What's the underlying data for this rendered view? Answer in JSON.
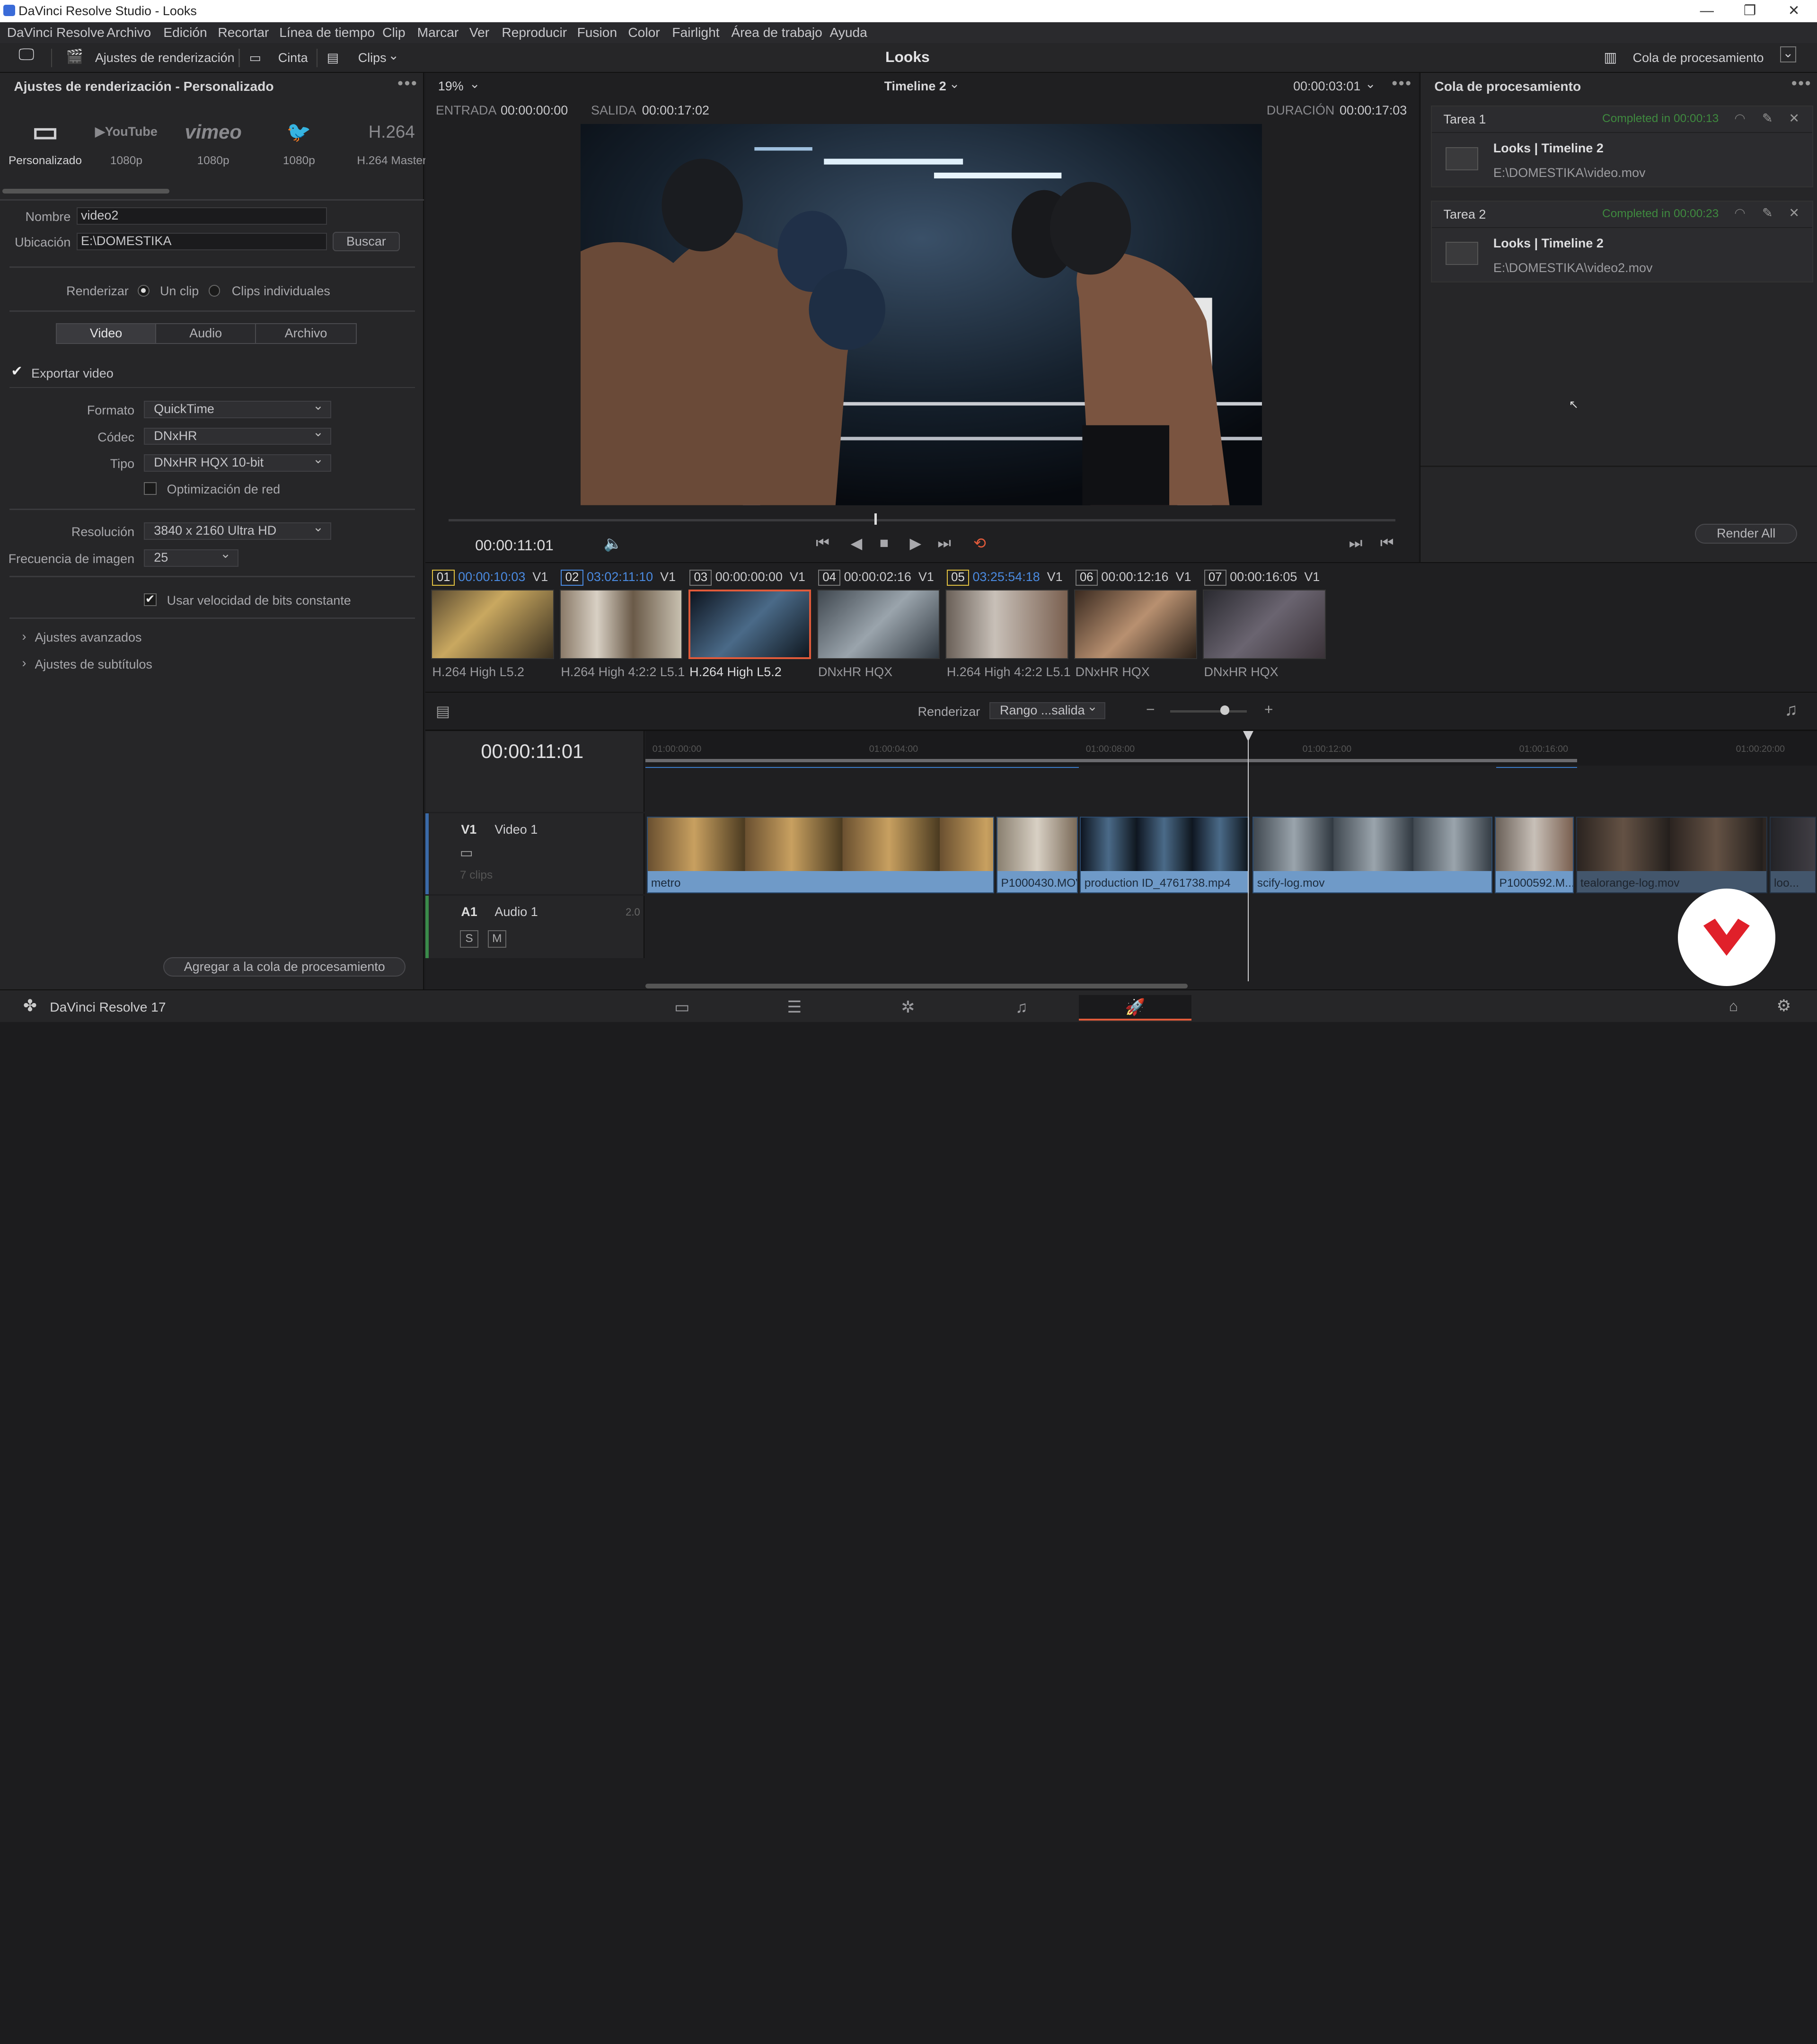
{
  "window": {
    "title": "DaVinci Resolve Studio - Looks",
    "minimize": "—",
    "restore": "❐",
    "close": "✕"
  },
  "menu": [
    "DaVinci Resolve",
    "Archivo",
    "Edición",
    "Recortar",
    "Línea de tiempo",
    "Clip",
    "Marcar",
    "Ver",
    "Reproducir",
    "Fusion",
    "Color",
    "Fairlight",
    "Área de trabajo",
    "Ayuda"
  ],
  "toolbar": {
    "render_settings": "Ajustes de renderización",
    "tape": "Cinta",
    "clips": "Clips",
    "project_title": "Looks",
    "render_queue": "Cola de procesamiento"
  },
  "render_settings": {
    "header": "Ajustes de renderización - Personalizado",
    "presets": [
      {
        "icon": "▭",
        "label": "Personalizado"
      },
      {
        "icon": "▶YouTube",
        "label": "1080p"
      },
      {
        "icon": "vimeo",
        "label": "1080p"
      },
      {
        "icon": "🐦",
        "label": "1080p"
      },
      {
        "icon": "H.264",
        "label": "H.264 Master"
      }
    ],
    "name_label": "Nombre",
    "name_value": "video2",
    "location_label": "Ubicación",
    "location_value": "E:\\DOMESTIKA",
    "browse": "Buscar",
    "render_label": "Renderizar",
    "single_clip": "Un clip",
    "individual_clips": "Clips individuales",
    "tabs": [
      "Video",
      "Audio",
      "Archivo"
    ],
    "export_video": "Exportar video",
    "format_label": "Formato",
    "format_value": "QuickTime",
    "codec_label": "Códec",
    "codec_value": "DNxHR",
    "type_label": "Tipo",
    "type_value": "DNxHR HQX 10-bit",
    "network_opt": "Optimización de red",
    "resolution_label": "Resolución",
    "resolution_value": "3840 x 2160 Ultra HD",
    "framerate_label": "Frecuencia de imagen",
    "framerate_value": "25",
    "cbr": "Usar velocidad de bits constante",
    "advanced": "Ajustes avanzados",
    "subtitles": "Ajustes de subtítulos",
    "add_queue": "Agregar a la cola de procesamiento"
  },
  "viewer": {
    "zoom": "19%",
    "timeline_name": "Timeline 2",
    "timecode_top": "00:00:03:01",
    "in_label": "ENTRADA",
    "in_value": "00:00:00:00",
    "out_label": "SALIDA",
    "out_value": "00:00:17:02",
    "dur_label": "DURACIÓN",
    "dur_value": "00:00:17:03",
    "current_tc": "00:00:11:01",
    "playhead_fraction": 0.45
  },
  "queue": {
    "header": "Cola de procesamiento",
    "jobs": [
      {
        "title": "Tarea 1",
        "status": "Completed in 00:00:13",
        "name": "Looks | Timeline 2",
        "path": "E:\\DOMESTIKA\\video.mov"
      },
      {
        "title": "Tarea 2",
        "status": "Completed in 00:00:23",
        "name": "Looks | Timeline 2",
        "path": "E:\\DOMESTIKA\\video2.mov"
      }
    ],
    "render_all": "Render All"
  },
  "clips": [
    {
      "num": "01",
      "tc": "00:00:10:03",
      "track": "V1",
      "codec": "H.264 High L5.2",
      "num_color": "y",
      "tc_color": "blue"
    },
    {
      "num": "02",
      "tc": "03:02:11:10",
      "track": "V1",
      "codec": "H.264 High 4:2:2 L5.1",
      "num_color": "b",
      "tc_color": "blue"
    },
    {
      "num": "03",
      "tc": "00:00:00:00",
      "track": "V1",
      "codec": "H.264 High L5.2",
      "num_color": "",
      "tc_color": ""
    },
    {
      "num": "04",
      "tc": "00:00:02:16",
      "track": "V1",
      "codec": "DNxHR HQX",
      "num_color": "",
      "tc_color": ""
    },
    {
      "num": "05",
      "tc": "03:25:54:18",
      "track": "V1",
      "codec": "H.264 High 4:2:2 L5.1",
      "num_color": "y",
      "tc_color": "blue"
    },
    {
      "num": "06",
      "tc": "00:00:12:16",
      "track": "V1",
      "codec": "DNxHR HQX",
      "num_color": "",
      "tc_color": ""
    },
    {
      "num": "07",
      "tc": "00:00:16:05",
      "track": "V1",
      "codec": "DNxHR HQX",
      "num_color": "",
      "tc_color": ""
    }
  ],
  "timeline": {
    "render_label": "Renderizar",
    "range_value": "Rango ...salida",
    "current_tc": "00:00:11:01",
    "ruler": [
      "01:00:00:00",
      "01:00:04:00",
      "01:00:08:00",
      "01:00:12:00",
      "01:00:16:00",
      "01:00:20:00"
    ],
    "v1_label": "V1",
    "v1_name": "Video 1",
    "v1_count": "7 clips",
    "a1_label": "A1",
    "a1_name": "Audio 1",
    "a1_ch": "2.0",
    "solo": "S",
    "mute": "M",
    "tl_clips": [
      "metro",
      "P1000430.MOV",
      "production ID_4761738.mp4",
      "scify-log.mov",
      "P1000592.M...",
      "tealorange-log.mov",
      "loo..."
    ]
  },
  "footer": {
    "app": "DaVinci Resolve 17"
  },
  "colors": {
    "accent": "#e05a3a",
    "completed": "#3f8a3f",
    "clip_blue": "#6f9ac8"
  }
}
